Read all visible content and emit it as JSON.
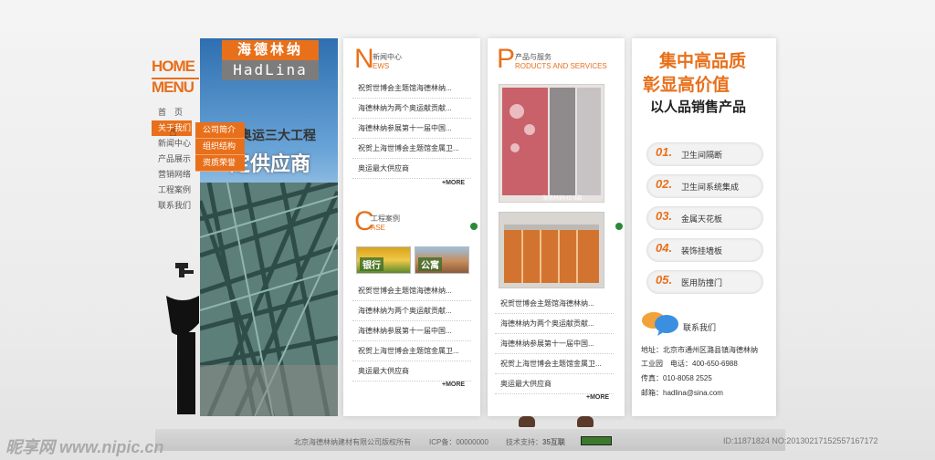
{
  "nav": {
    "home_logo": "HOME",
    "menu_logo": "MENU",
    "items": [
      "首　页",
      "关于我们",
      "新闻中心",
      "产品展示",
      "营销网络",
      "工程案例",
      "联系我们"
    ],
    "dropdown": [
      "公司简介",
      "组织结构",
      "资质荣誉"
    ]
  },
  "banner": {
    "logo_cn": "海德林纳",
    "logo_en": "HadLina",
    "line1": "奥运三大工程",
    "line2": "定供应商"
  },
  "news": {
    "letter": "N",
    "title_cn": "新闻中心",
    "title_en": "EWS",
    "items": [
      "祝贺世博会主题馆海德林纳...",
      "海德林纳为两个奥运献贡献...",
      "海德林纳参展第十一届中国...",
      "祝贺上海世博会主题馆金属卫...",
      "奥运最大供应商"
    ],
    "more": "+MORE"
  },
  "cases": {
    "letter": "C",
    "title_cn": "工程案例",
    "title_en": "ASE",
    "thumbs": [
      "银行",
      "公寓"
    ],
    "items": [
      "祝贺世博会主题馆海德林纳...",
      "海德林纳为两个奥运献贡献...",
      "海德林纳参展第十一届中国...",
      "祝贺上海世博会主题馆金属卫...",
      "奥运最大供应商"
    ],
    "more": "+MORE"
  },
  "products": {
    "letter": "P",
    "title_cn": "产品与服务",
    "title_en": "RODUCTS AND SERVICES",
    "photo_caption": "海德林纳HD 6款",
    "items": [
      "祝贺世博会主题馆海德林纳...",
      "海德林纳为两个奥运献贡献...",
      "海德林纳参展第十一届中国...",
      "祝贺上海世博会主题馆金属卫...",
      "奥运最大供应商"
    ],
    "more": "+MORE"
  },
  "right": {
    "slogan1": "集中高品质",
    "slogan2": "彰显高价值",
    "slogan3": "以人品销售产品",
    "list": [
      {
        "num": "01.",
        "label": "卫生间隔断"
      },
      {
        "num": "02.",
        "label": "卫生间系统集成"
      },
      {
        "num": "03.",
        "label": "金属天花板"
      },
      {
        "num": "04.",
        "label": "装饰挂墙板"
      },
      {
        "num": "05.",
        "label": "医用防撞门"
      }
    ],
    "contact_title": "联系我们",
    "address": "地址：北京市通州区潞县镇海德林纳",
    "industry": "工业园　电话：400-650-6988",
    "fax": "传真：010-8058 2525",
    "email": "邮箱：hadlina@sina.com"
  },
  "footer": {
    "copyright": "北京海德林纳建材有限公司版权所有",
    "icp": "ICP备：00000000",
    "support": "技术支持：",
    "support_name": "35互联"
  },
  "watermark": {
    "left": "昵享网 www.nipic.cn",
    "right": "ID:11871824 NO:20130217152557167172"
  },
  "colors": {
    "accent": "#e8701b",
    "panel": "#ffffff",
    "background": "#ededed"
  }
}
